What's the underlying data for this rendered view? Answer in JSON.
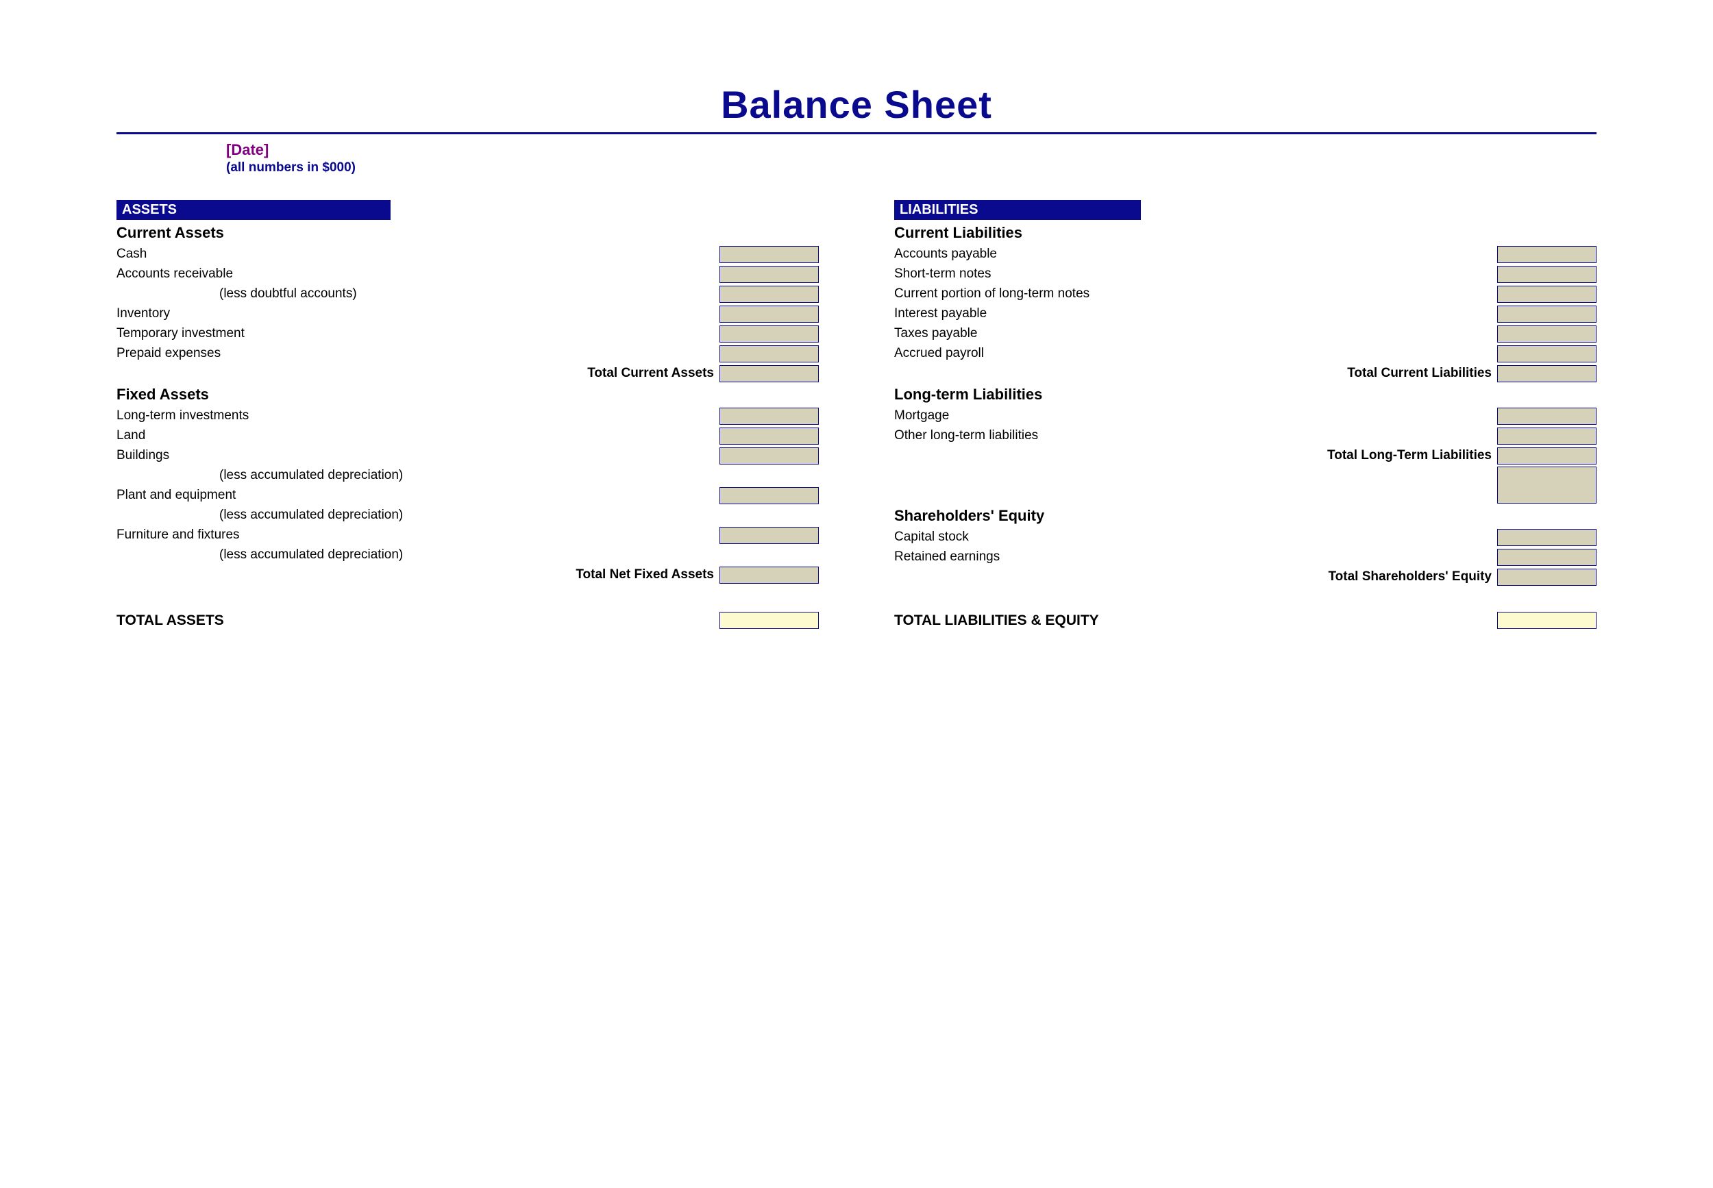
{
  "title": "Balance Sheet",
  "meta": {
    "date": "[Date]",
    "note": "(all numbers in $000)"
  },
  "assets": {
    "header": "ASSETS",
    "current": {
      "heading": "Current Assets",
      "items": {
        "cash": "Cash",
        "ar": "Accounts receivable",
        "less_doubtful": "(less doubtful accounts)",
        "inventory": "Inventory",
        "temp_inv": "Temporary investment",
        "prepaid": "Prepaid expenses"
      },
      "total": "Total Current Assets"
    },
    "fixed": {
      "heading": "Fixed Assets",
      "items": {
        "lti": "Long-term investments",
        "land": "Land",
        "buildings": "Buildings",
        "less_dep1": "(less accumulated depreciation)",
        "plant": "Plant and equipment",
        "less_dep2": "(less accumulated depreciation)",
        "furniture": "Furniture and fixtures",
        "less_dep3": "(less accumulated depreciation)"
      },
      "total": "Total Net Fixed Assets"
    },
    "grand_total": "TOTAL ASSETS"
  },
  "liabilities": {
    "header": "LIABILITIES",
    "current": {
      "heading": "Current Liabilities",
      "items": {
        "ap": "Accounts payable",
        "st_notes": "Short-term notes",
        "cp_lt": "Current portion of long-term notes",
        "interest": "Interest payable",
        "taxes": "Taxes payable",
        "payroll": "Accrued payroll"
      },
      "total": "Total Current Liabilities"
    },
    "longterm": {
      "heading": "Long-term Liabilities",
      "items": {
        "mortgage": "Mortgage",
        "other": "Other long-term liabilities"
      },
      "total": "Total Long-Term Liabilities"
    },
    "equity": {
      "heading": "Shareholders' Equity",
      "items": {
        "capital": "Capital stock",
        "retained": "Retained earnings"
      },
      "total": "Total Shareholders' Equity"
    },
    "grand_total": "TOTAL LIABILITIES & EQUITY"
  }
}
